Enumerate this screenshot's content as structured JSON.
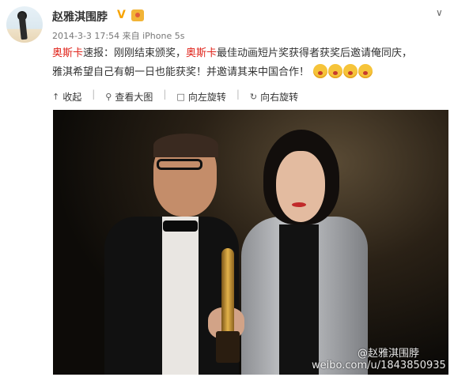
{
  "post": {
    "username": "赵雅淇围脖",
    "verified_badge": "V",
    "meta": "2014-3-3 17:54 来自 iPhone 5s",
    "text": {
      "seg1": "奥斯卡",
      "seg2": "速报：刚刚结束颁奖，",
      "seg3": "奥斯卡",
      "seg4": "最佳动画短片奖获得者获奖后邀请俺同庆，",
      "seg5": "雅淇希望自己有朝一日也能获奖！并邀请其来中国合作！"
    },
    "emoji_icons": [
      "shocked-face-icon",
      "shocked-face-icon",
      "hug-face-icon",
      "hug-face-icon"
    ]
  },
  "toolbar": {
    "collapse": "收起",
    "view_large": "查看大图",
    "rotate_left": "向左旋转",
    "rotate_right": "向右旋转",
    "icons": [
      "arrow-up-icon",
      "magnifier-icon",
      "image-icon",
      "rotate-icon"
    ]
  },
  "photo": {
    "watermark_handle": "@赵雅淇围脖",
    "watermark_url": "weibo.com/u/1843850935"
  },
  "colors": {
    "highlight": "#e0241b",
    "badge": "#f7a300",
    "text": "#333333",
    "meta": "#777777"
  }
}
